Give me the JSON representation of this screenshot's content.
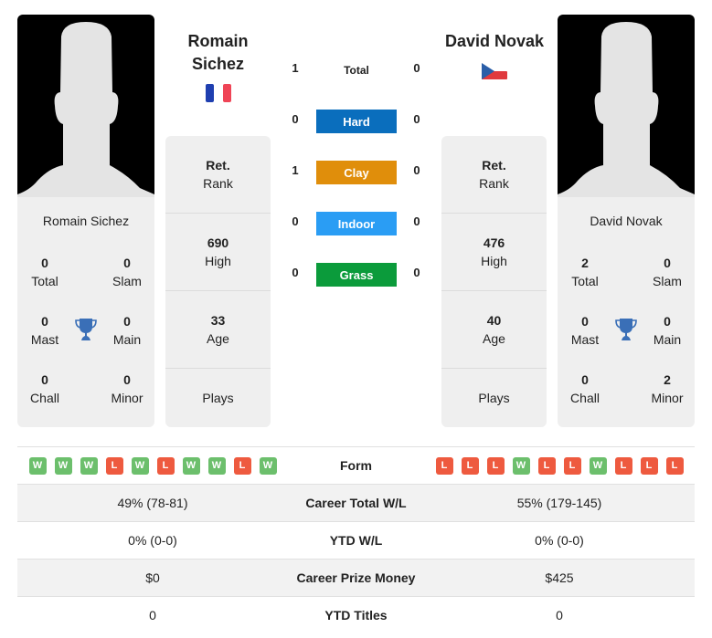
{
  "colors": {
    "hard": "#0a6ebd",
    "clay": "#e08e0b",
    "indoor": "#2a9df4",
    "grass": "#0b9b3b",
    "win": "#6cbf6c",
    "loss": "#ee5a3f",
    "trophy": "#3a6fb7"
  },
  "player1": {
    "name_line1": "Romain",
    "name_line2": "Sichez",
    "card_name": "Romain Sichez",
    "flag": "France",
    "titles": {
      "total": "0",
      "total_label": "Total",
      "slam": "0",
      "slam_label": "Slam",
      "mast": "0",
      "mast_label": "Mast",
      "main": "0",
      "main_label": "Main",
      "chall": "0",
      "chall_label": "Chall",
      "minor": "0",
      "minor_label": "Minor"
    },
    "rank_value": "Ret.",
    "rank_label": "Rank",
    "high_value": "690",
    "high_label": "High",
    "age_value": "33",
    "age_label": "Age",
    "plays_label": "Plays",
    "form": [
      "W",
      "W",
      "W",
      "L",
      "W",
      "L",
      "W",
      "W",
      "L",
      "W"
    ],
    "career_wl": "49% (78-81)",
    "ytd_wl": "0% (0-0)",
    "prize": "$0",
    "ytd_titles": "0"
  },
  "player2": {
    "name": "David Novak",
    "card_name": "David Novak",
    "flag": "Czech Republic",
    "titles": {
      "total": "2",
      "total_label": "Total",
      "slam": "0",
      "slam_label": "Slam",
      "mast": "0",
      "mast_label": "Mast",
      "main": "0",
      "main_label": "Main",
      "chall": "0",
      "chall_label": "Chall",
      "minor": "2",
      "minor_label": "Minor"
    },
    "rank_value": "Ret.",
    "rank_label": "Rank",
    "high_value": "476",
    "high_label": "High",
    "age_value": "40",
    "age_label": "Age",
    "plays_label": "Plays",
    "form": [
      "L",
      "L",
      "L",
      "W",
      "L",
      "L",
      "W",
      "L",
      "L",
      "L"
    ],
    "career_wl": "55% (179-145)",
    "ytd_wl": "0% (0-0)",
    "prize": "$425",
    "ytd_titles": "0"
  },
  "h2h": {
    "total": {
      "label": "Total",
      "p1": "1",
      "p2": "0"
    },
    "hard": {
      "label": "Hard",
      "p1": "0",
      "p2": "0"
    },
    "clay": {
      "label": "Clay",
      "p1": "1",
      "p2": "0"
    },
    "indoor": {
      "label": "Indoor",
      "p1": "0",
      "p2": "0"
    },
    "grass": {
      "label": "Grass",
      "p1": "0",
      "p2": "0"
    }
  },
  "table": {
    "form_label": "Form",
    "career_wl_label": "Career Total W/L",
    "ytd_wl_label": "YTD W/L",
    "prize_label": "Career Prize Money",
    "ytd_titles_label": "YTD Titles"
  }
}
